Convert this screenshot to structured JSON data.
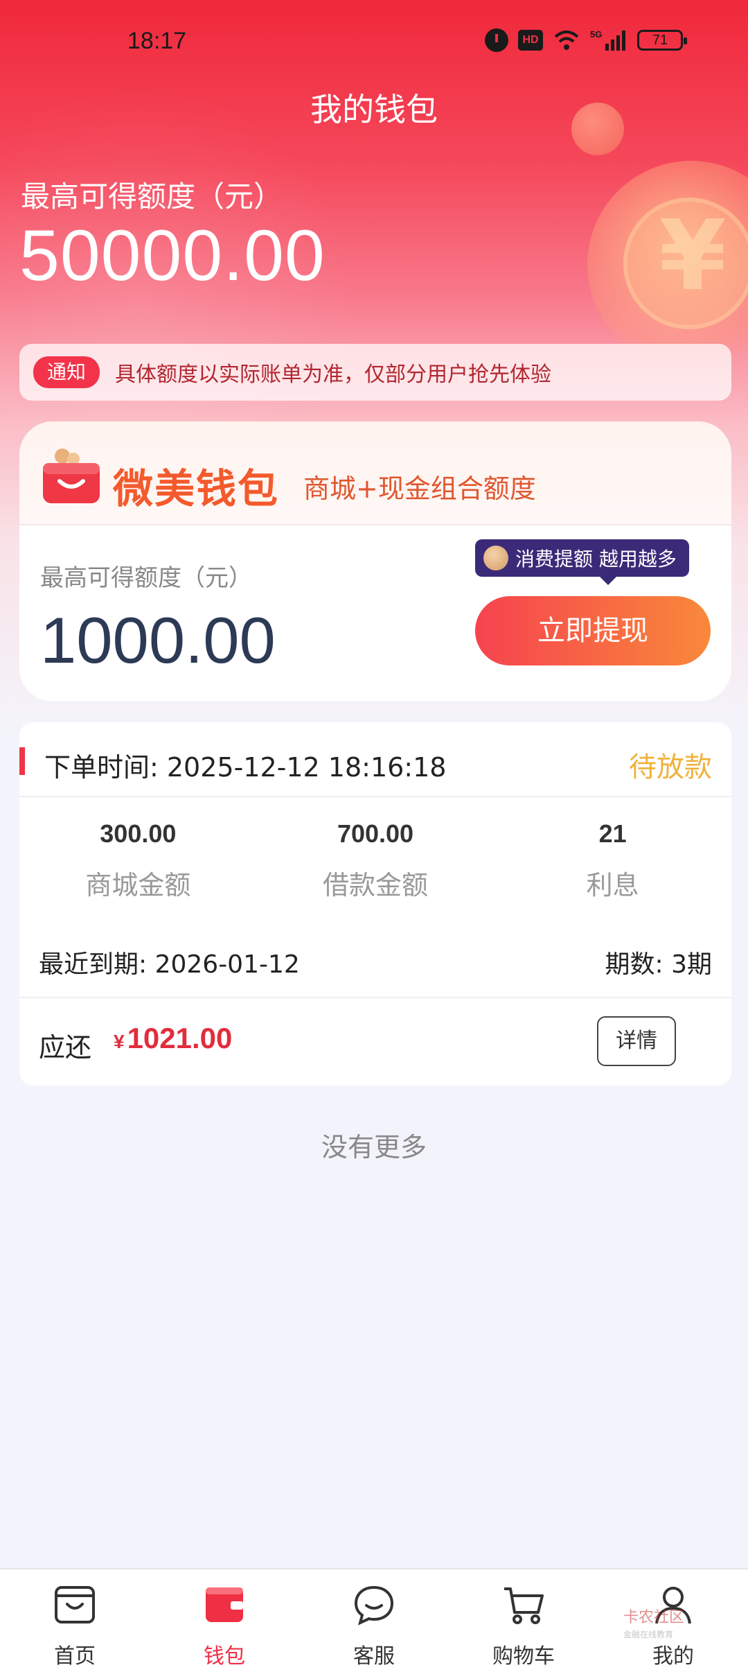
{
  "status_bar": {
    "time": "18:17",
    "battery": "71"
  },
  "header": {
    "title": "我的钱包"
  },
  "hero": {
    "label": "最高可得额度（元）",
    "amount": "50000.00"
  },
  "notice": {
    "tag": "通知",
    "text": "具体额度以实际账单为准，仅部分用户抢先体验"
  },
  "wallet": {
    "brand": "微美钱包",
    "subtitle": "商城+现金组合额度",
    "label": "最高可得额度（元）",
    "amount": "1000.00",
    "tip": "消费提额 越用越多",
    "button": "立即提现"
  },
  "order": {
    "time": "下单时间: 2025-12-12 18:16:18",
    "status": "待放款",
    "stats": [
      {
        "value": "300.00",
        "label": "商城金额"
      },
      {
        "value": "700.00",
        "label": "借款金额"
      },
      {
        "value": "21",
        "label": "利息"
      }
    ],
    "due": "最近到期: 2026-01-12",
    "periods": "期数: 3期",
    "repay_label": "应还",
    "repay_currency": "¥",
    "repay_amount": "1021.00",
    "detail_button": "详情"
  },
  "no_more": "没有更多",
  "nav": [
    {
      "label": "首页",
      "icon": "home-bag-icon",
      "active": false
    },
    {
      "label": "钱包",
      "icon": "wallet-icon",
      "active": true
    },
    {
      "label": "客服",
      "icon": "chat-icon",
      "active": false
    },
    {
      "label": "购物车",
      "icon": "cart-icon",
      "active": false
    },
    {
      "label": "我的",
      "icon": "user-icon",
      "active": false
    }
  ],
  "watermark": {
    "title": "卡农社区",
    "subtitle": "金融在线教育"
  },
  "colors": {
    "accent": "#f2334a",
    "gradient_start": "#f6434f",
    "gradient_end": "#f9893a",
    "status": "#f0b23a",
    "amount_red": "#e12d3c"
  }
}
